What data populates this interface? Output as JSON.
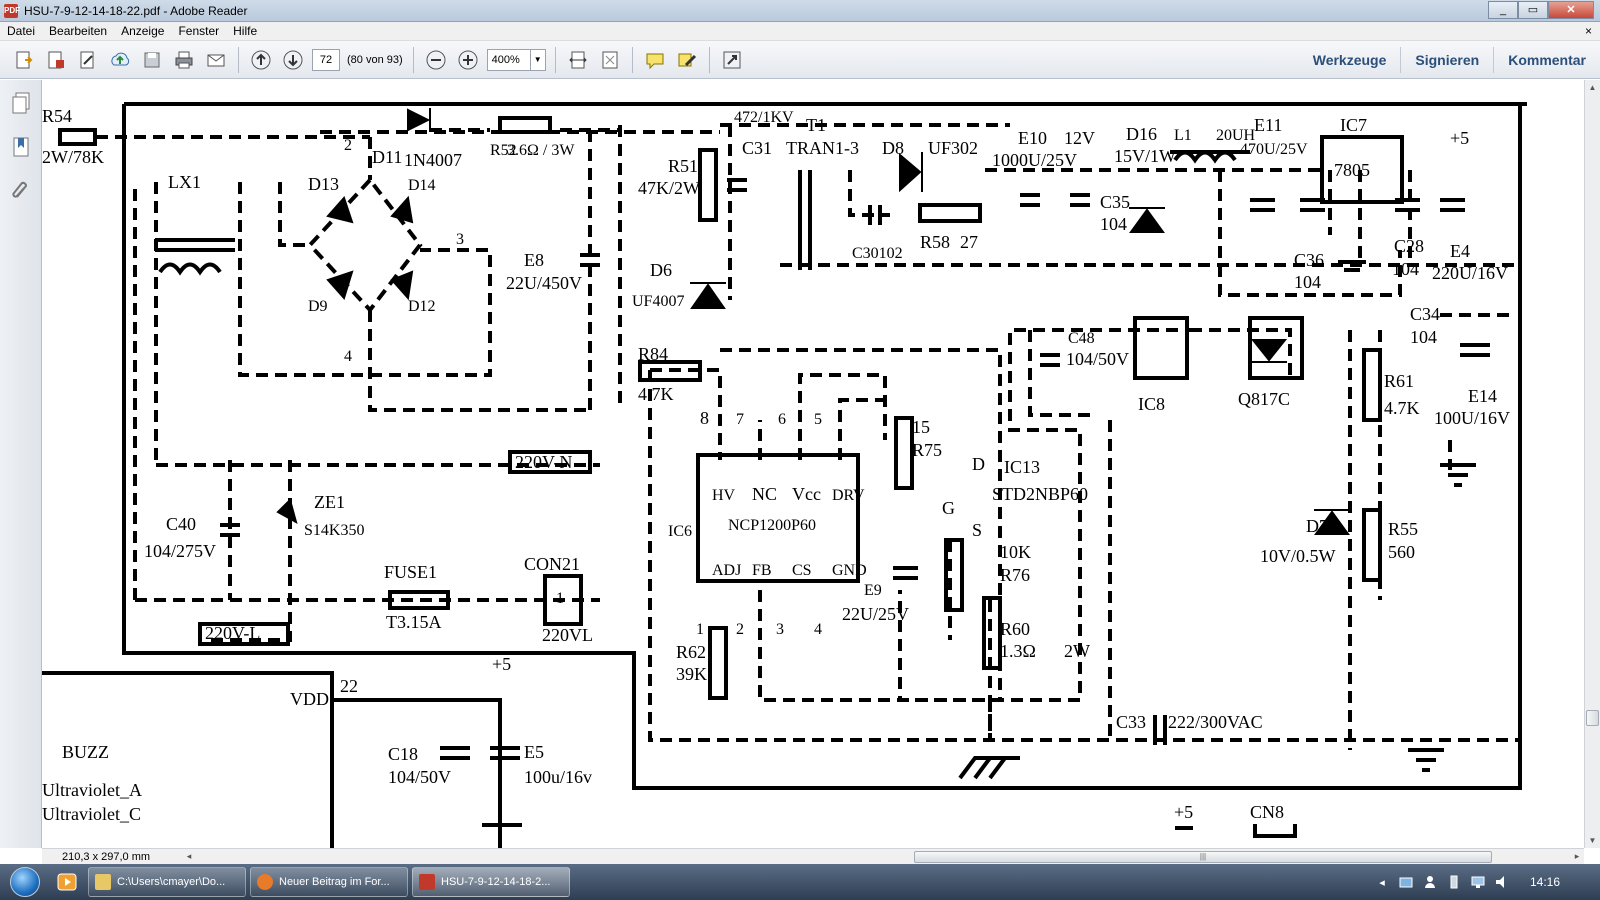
{
  "window": {
    "title": "HSU-7-9-12-14-18-22.pdf - Adobe Reader",
    "controls": {
      "minimize": "_",
      "maximize": "▭",
      "close": "✕"
    }
  },
  "menu": {
    "items": [
      "Datei",
      "Bearbeiten",
      "Anzeige",
      "Fenster",
      "Hilfe"
    ],
    "close": "×"
  },
  "toolbar": {
    "page_number": "72",
    "page_count": "(80 von 93)",
    "zoom": "400%",
    "zoom_arrow": "▼",
    "panes": [
      "Werkzeuge",
      "Signieren",
      "Kommentar"
    ]
  },
  "statusbar": {
    "page_size": "210,3 x 297,0 mm",
    "left_arrow": "◂",
    "right_arrow": "▸",
    "grip": "|||"
  },
  "scrollbar": {
    "up": "▲",
    "down": "▼"
  },
  "taskbar": {
    "tasks": [
      {
        "label": "C:\\Users\\cmayer\\Do...",
        "color": "#e8c766"
      },
      {
        "label": "Neuer Beitrag im For...",
        "color": "#e87b2a"
      },
      {
        "label": "HSU-7-9-12-14-18-2...",
        "color": "#c0392b"
      }
    ],
    "tray_expand": "◂",
    "clock": "14:16"
  },
  "schematic": {
    "labels": [
      "R54",
      "2W/78K",
      "2",
      "D11",
      "1N4007",
      "R52",
      "3.6Ω / 3W",
      "472/1KV",
      "T1",
      "TRAN1-3",
      "D8",
      "UF302",
      "E10",
      "1000U/25V",
      "12V",
      "D16",
      "15V/1W",
      "L1",
      "20UH",
      "E11",
      "470U/25V",
      "IC7",
      "7805",
      "+5",
      "LX1",
      "D13",
      "D14",
      "D9",
      "D12",
      "3",
      "4",
      "E8",
      "22U/450V",
      "R51",
      "47K/2W",
      "C31",
      "D6",
      "UF4007",
      "C30102",
      "R58",
      "27",
      "C35",
      "104",
      "C36",
      "104",
      "C28",
      "104",
      "E4",
      "220U/16V",
      "R84",
      "4.7K",
      "8",
      "7",
      "6",
      "5",
      "C48",
      "104/50V",
      "IC8",
      "Q817C",
      "C34",
      "104",
      "R61",
      "4.7K",
      "E14",
      "100U/16V",
      "220V-N",
      "C40",
      "104/275V",
      "ZE1",
      "S14K350",
      "15",
      "R75",
      "D",
      "IC13",
      "STD2NBP60",
      "G",
      "S",
      "HV",
      "NC",
      "Vcc",
      "DRV",
      "ADJ",
      "FB",
      "CS",
      "GND",
      "IC6",
      "NCP1200P60",
      "E9",
      "22U/25V",
      "10K",
      "R76",
      "D7",
      "10V/0.5W",
      "R55",
      "560",
      "FUSE1",
      "T3.15A",
      "CON21",
      "1",
      "220VL",
      "220V-L",
      "R62",
      "39K",
      "1",
      "2",
      "3",
      "4",
      "R60",
      "1.3Ω",
      "2W",
      "C33",
      "222/300VAC",
      "VDD",
      "22",
      "+5",
      "C18",
      "104/50V",
      "E5",
      "100u/16v",
      "BUZZ",
      "Ultraviolet_A",
      "Ultraviolet_C",
      "+5",
      "CN8"
    ]
  }
}
